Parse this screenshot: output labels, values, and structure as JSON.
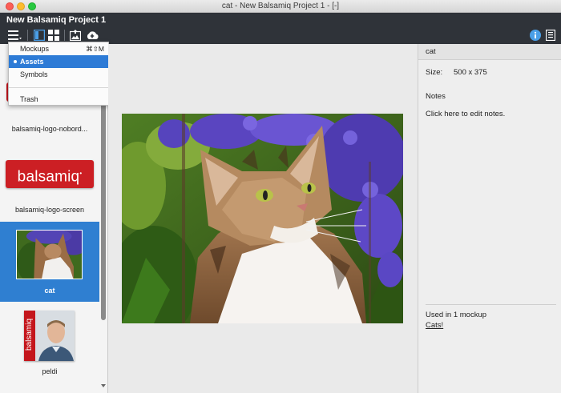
{
  "window": {
    "title": "cat - New Balsamiq Project 1 - [-]"
  },
  "project": {
    "name": "New Balsamiq Project 1"
  },
  "toolbar": {
    "icons": [
      "hamburger-menu-icon",
      "single-panel-view-icon",
      "grid-view-icon",
      "import-image-icon",
      "cloud-upload-icon",
      "info-icon",
      "notes-icon"
    ]
  },
  "menu": {
    "items": [
      {
        "label": "Mockups",
        "shortcut": "⌘⇧M"
      },
      {
        "label": "Assets",
        "selected": true
      },
      {
        "label": "Symbols"
      },
      {
        "label": "Trash"
      }
    ]
  },
  "assets": {
    "items": [
      {
        "label": "balsamiq-logo-nobord..."
      },
      {
        "label": "balsamiq-logo-screen",
        "logo_text": "balsamiq"
      },
      {
        "label": "cat",
        "selected": true
      },
      {
        "label": "peldi",
        "logo_text": "balsamiq"
      }
    ]
  },
  "inspector": {
    "name": "cat",
    "size_label": "Size:",
    "size_value": "500 x 375",
    "notes_label": "Notes",
    "notes_placeholder": "Click here to edit notes.",
    "usage_text": "Used in 1 mockup",
    "usage_link": "Cats!"
  },
  "colors": {
    "brand_red": "#cc1f24",
    "selection_blue": "#2f7fd1",
    "menu_highlight": "#2d7bd6",
    "toolbar_bg": "#2f3339"
  }
}
